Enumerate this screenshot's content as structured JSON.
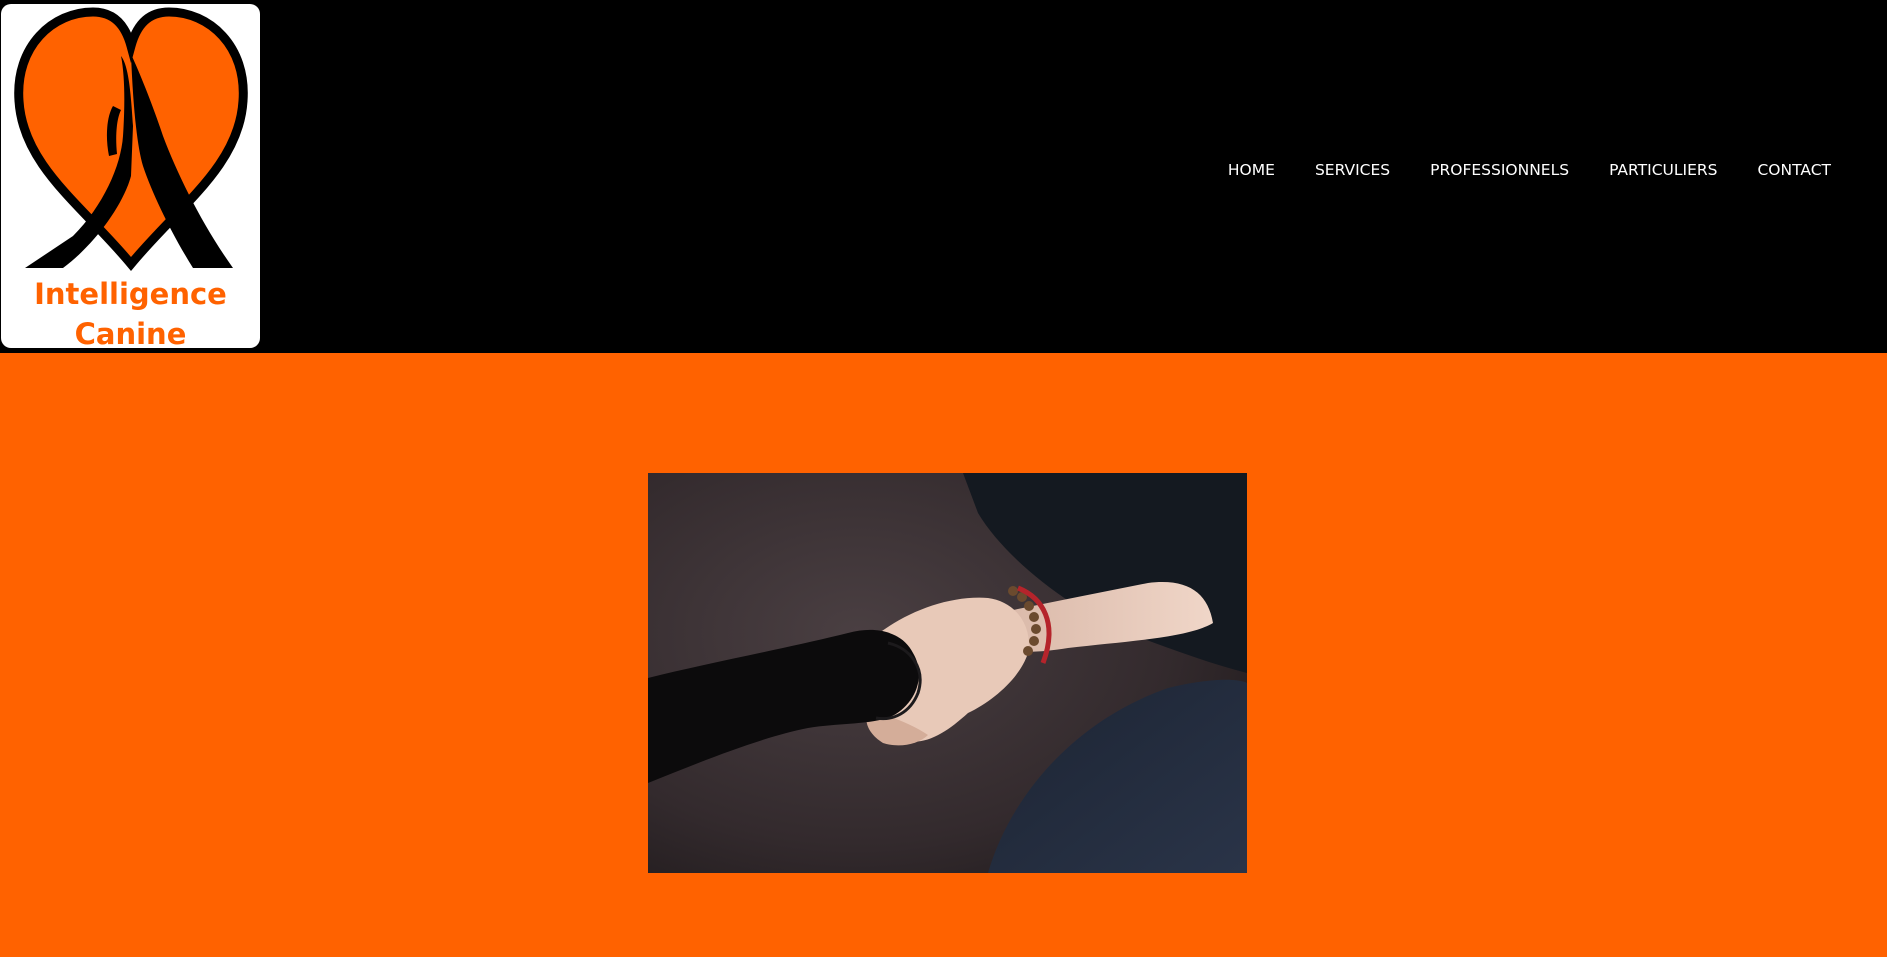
{
  "brand": {
    "line1": "Intelligence",
    "line2": "Canine",
    "color": "#ff6200"
  },
  "nav": {
    "items": [
      {
        "label": "HOME"
      },
      {
        "label": "SERVICES"
      },
      {
        "label": "PROFESSIONNELS"
      },
      {
        "label": "PARTICULIERS"
      },
      {
        "label": "CONTACT"
      }
    ]
  },
  "colors": {
    "header_bg": "#000000",
    "hero_bg": "#ff6200",
    "nav_text": "#ffffff"
  },
  "hero": {
    "image": "dog-paw-in-human-hand-photo"
  }
}
